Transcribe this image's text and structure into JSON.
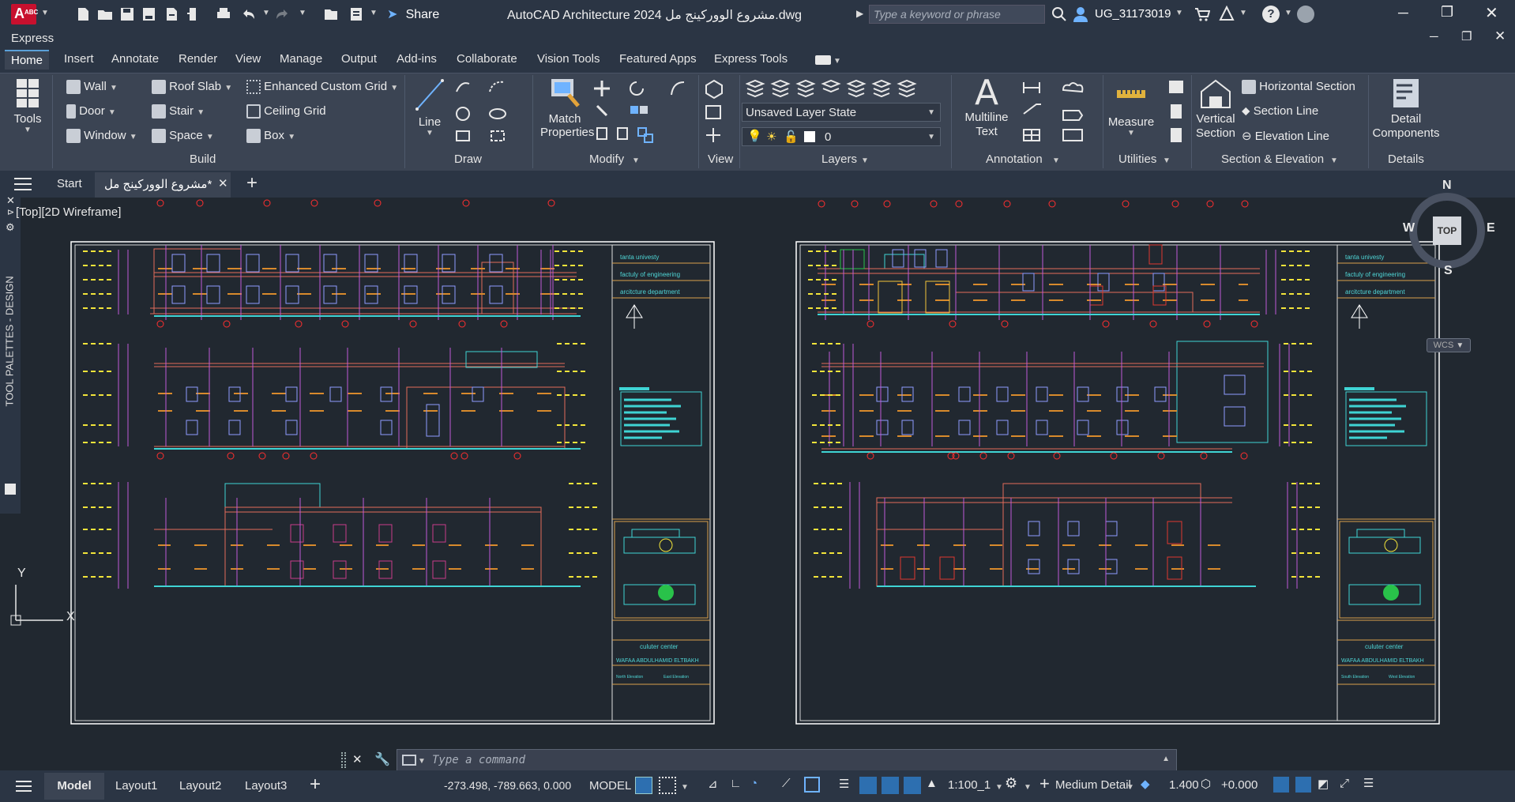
{
  "app": {
    "title": "AutoCAD Architecture 2024  مشروع الووركينج مل.dwg",
    "logo_label": "A",
    "logo_sub": "ABC",
    "share_label": "Share",
    "search_placeholder": "Type a keyword or phrase",
    "user": "UG_31173019",
    "express_label": "Express"
  },
  "ribbon_tabs": [
    "Home",
    "Insert",
    "Annotate",
    "Render",
    "View",
    "Manage",
    "Output",
    "Add-ins",
    "Collaborate",
    "Vision Tools",
    "Featured Apps",
    "Express Tools"
  ],
  "ribbon": {
    "tools_label": "Tools",
    "build": {
      "title": "Build",
      "wall": "Wall",
      "door": "Door",
      "window": "Window",
      "roof_slab": "Roof Slab",
      "stair": "Stair",
      "space": "Space",
      "enhanced_grid": "Enhanced Custom Grid",
      "ceiling_grid": "Ceiling Grid",
      "box": "Box"
    },
    "draw": {
      "title": "Draw",
      "line": "Line"
    },
    "modify": {
      "title": "Modify",
      "match_properties_1": "Match",
      "match_properties_2": "Properties"
    },
    "view": {
      "title": "View"
    },
    "layers": {
      "title": "Layers",
      "layer_state": "Unsaved Layer State",
      "current_layer": "0"
    },
    "annotation": {
      "title": "Annotation",
      "mtext_1": "Multiline",
      "mtext_2": "Text"
    },
    "utilities": {
      "title": "Utilities",
      "measure": "Measure"
    },
    "section": {
      "title": "Section & Elevation",
      "vertical_1": "Vertical",
      "vertical_2": "Section",
      "horizontal": "Horizontal Section",
      "section_line": "Section Line",
      "elevation_line": "Elevation Line"
    },
    "details": {
      "title": "Details",
      "detail_1": "Detail",
      "detail_2": "Components"
    }
  },
  "doc_tabs": {
    "start": "Start",
    "active": "مشروع الووركينج مل*"
  },
  "viewport": {
    "label": "[Top][2D Wireframe]",
    "tool_palette": "TOOL PALETTES - DESIGN"
  },
  "viewcube": {
    "n": "N",
    "s": "S",
    "e": "E",
    "w": "W",
    "top": "TOP",
    "wcs": "WCS"
  },
  "ucs": {
    "x": "X",
    "y": "Y"
  },
  "sheet_text": {
    "univ": "tanta univesty",
    "faculty": "factuly of engineering",
    "dept": "arcitcture department",
    "project": "culuter center",
    "student": "WAFAA ABDULHAMID ELTBAKH",
    "north_elev": "North Elevation",
    "south_elev": "South Elevation",
    "east_elev": "East Elevation",
    "west_elev": "West Elevation"
  },
  "command": {
    "placeholder": "Type a command"
  },
  "status": {
    "model": "Model",
    "layouts": [
      "Layout1",
      "Layout2",
      "Layout3"
    ],
    "coords": "-273.498, -789.663, 0.000",
    "space": "MODEL",
    "scale": "1:100_1",
    "detail": "Medium Detail",
    "elev": "1.400",
    "offset": "+0.000"
  }
}
